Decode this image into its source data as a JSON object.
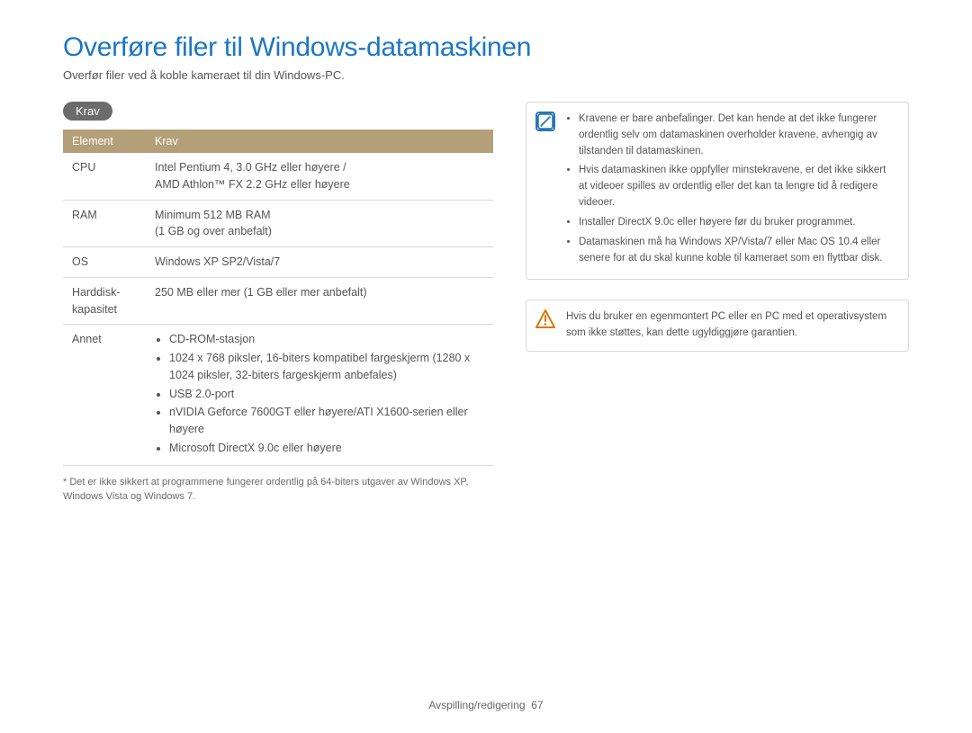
{
  "title": "Overføre filer til Windows-datamaskinen",
  "subtitle": "Overfør filer ved å koble kameraet til din Windows-PC.",
  "section_badge": "Krav",
  "table": {
    "head": {
      "c1": "Element",
      "c2": "Krav"
    },
    "rows": {
      "cpu": {
        "label": "CPU",
        "value_line1": "Intel Pentium 4, 3.0 GHz eller høyere /",
        "value_line2": "AMD Athlon™ FX 2.2 GHz eller høyere"
      },
      "ram": {
        "label": "RAM",
        "value_line1": "Minimum 512 MB RAM",
        "value_line2": "(1 GB og over anbefalt)"
      },
      "os": {
        "label": "OS",
        "value": "Windows XP SP2/Vista/7"
      },
      "hdd": {
        "label": "Harddisk-kapasitet",
        "value": "250 MB eller mer (1 GB eller mer anbefalt)"
      },
      "other": {
        "label": "Annet",
        "items": [
          "CD-ROM-stasjon",
          "1024 x 768 piksler, 16-biters kompatibel fargeskjerm (1280 x 1024 piksler, 32-biters fargeskjerm anbefales)",
          "USB 2.0-port",
          "nVIDIA Geforce 7600GT eller høyere/ATI X1600-serien eller høyere",
          "Microsoft DirectX 9.0c eller høyere"
        ]
      }
    }
  },
  "footnote": "* Det er ikke sikkert at programmene fungerer ordentlig på 64-biters utgaver av Windows XP, Windows Vista og Windows 7.",
  "info_notes": [
    "Kravene er bare anbefalinger. Det kan hende at det ikke fungerer ordentlig selv om datamaskinen overholder kravene, avhengig av tilstanden til datamaskinen.",
    "Hvis datamaskinen ikke oppfyller minstekravene, er det ikke sikkert at videoer spilles av ordentlig eller det kan ta lengre tid å redigere videoer.",
    "Installer DirectX 9.0c eller høyere før du bruker programmet.",
    "Datamaskinen må ha Windows XP/Vista/7 eller Mac OS 10.4 eller senere for at du skal kunne koble til kameraet som en flyttbar disk."
  ],
  "warning_note": "Hvis du bruker en egenmontert PC eller en PC med et operativsystem som ikke støttes, kan dette ugyldiggjøre garantien.",
  "footer": {
    "section": "Avspilling/redigering",
    "page": "67"
  }
}
